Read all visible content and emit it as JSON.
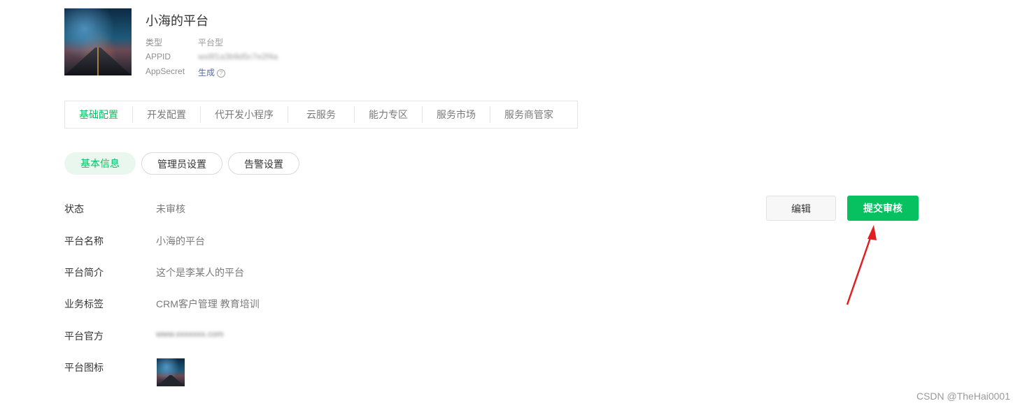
{
  "account": {
    "name": "小海的平台",
    "type_label": "类型",
    "type_value": "平台型",
    "appid_label": "APPID",
    "appid_value": "wx8f1a3b9d5c7e2f4a",
    "secret_label": "AppSecret",
    "secret_action": "生成",
    "help_glyph": "?"
  },
  "nav": {
    "items": [
      "基础配置",
      "开发配置",
      "代开发小程序",
      "云服务",
      "能力专区",
      "服务市场",
      "服务商管家"
    ],
    "active_index": 0
  },
  "subtabs": {
    "items": [
      "基本信息",
      "管理员设置",
      "告警设置"
    ],
    "active_index": 0
  },
  "fields": {
    "status_label": "状态",
    "status_value": "未审核",
    "name_label": "平台名称",
    "name_value": "小海的平台",
    "intro_label": "平台简介",
    "intro_value": "这个是李某人的平台",
    "tags_label": "业务标签",
    "tags_value": "CRM客户管理 教育培训",
    "site_label": "平台官方",
    "site_value": "www.xxxxxxx.com",
    "icon_label": "平台图标"
  },
  "actions": {
    "edit_label": "编辑",
    "submit_label": "提交审核"
  },
  "colors": {
    "accent": "#07c160",
    "annotation_arrow": "#e02020",
    "link": "#576b95"
  },
  "watermark": "CSDN @TheHai0001"
}
